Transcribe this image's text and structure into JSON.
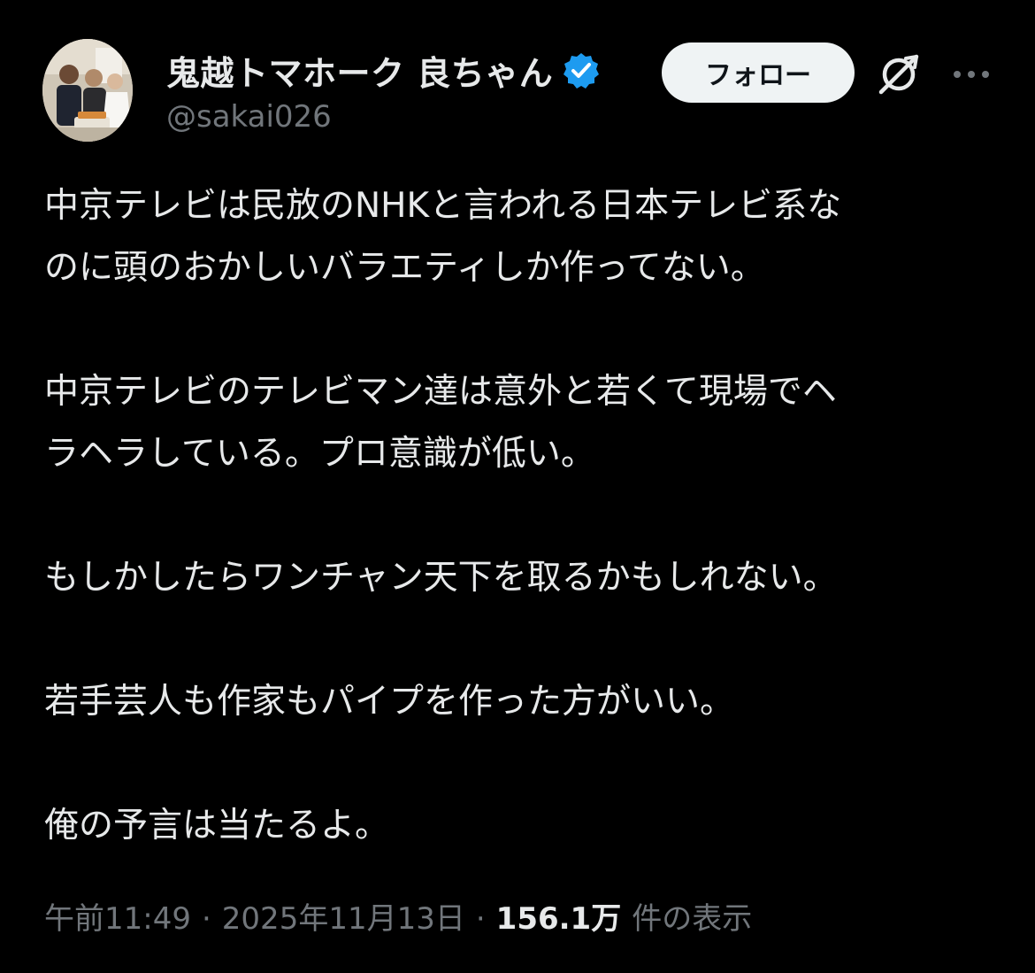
{
  "author": {
    "display_name": "鬼越トマホーク 良ちゃん",
    "handle": "@sakai026",
    "verified": true,
    "verified_color": "#1d9bf0"
  },
  "actions": {
    "follow_label": "フォロー",
    "grok_icon": "grok-icon",
    "more_icon": "more-icon"
  },
  "tweet": {
    "paragraphs": [
      "中京テレビは民放のNHKと言われる日本テレビ系な\nのに頭のおかしいバラエティしか作ってない。",
      "中京テレビのテレビマン達は意外と若くて現場でヘ\nラヘラしている。プロ意識が低い。",
      "もしかしたらワンチャン天下を取るかもしれない。",
      "若手芸人も作家もパイプを作った方がいい。",
      "俺の予言は当たるよ。"
    ]
  },
  "meta": {
    "time": "午前11:49",
    "separator": "·",
    "date": "2025年11月13日",
    "views_count": "156.1万",
    "views_label": "件の表示"
  },
  "colors": {
    "background": "#000000",
    "text_primary": "#e7e9ea",
    "text_secondary": "#71767b",
    "button_bg": "#eff3f4",
    "button_text": "#0f1419"
  }
}
